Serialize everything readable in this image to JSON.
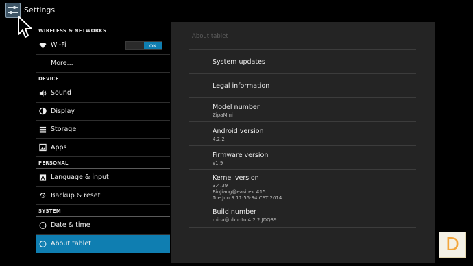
{
  "app": {
    "title": "Settings"
  },
  "sidebar": {
    "sections": [
      {
        "header": "WIRELESS & NETWORKS",
        "items": [
          {
            "label": "Wi-Fi",
            "icon": "wifi-icon",
            "toggle": "ON"
          },
          {
            "label": "More...",
            "icon": ""
          }
        ]
      },
      {
        "header": "DEVICE",
        "items": [
          {
            "label": "Sound",
            "icon": "volume-icon"
          },
          {
            "label": "Display",
            "icon": "brightness-icon"
          },
          {
            "label": "Storage",
            "icon": "storage-icon"
          },
          {
            "label": "Apps",
            "icon": "apps-icon"
          }
        ]
      },
      {
        "header": "PERSONAL",
        "items": [
          {
            "label": "Language & input",
            "icon": "keyboard-icon"
          },
          {
            "label": "Backup & reset",
            "icon": "backup-icon"
          }
        ]
      },
      {
        "header": "SYSTEM",
        "items": [
          {
            "label": "Date & time",
            "icon": "clock-icon"
          },
          {
            "label": "About tablet",
            "icon": "info-icon",
            "selected": true
          }
        ]
      }
    ]
  },
  "panel": {
    "title": "About tablet",
    "rows": [
      {
        "title": "System updates"
      },
      {
        "title": "Legal information"
      },
      {
        "title": "Model number",
        "sub": [
          "ZipaMini"
        ]
      },
      {
        "title": "Android version",
        "sub": [
          "4.2.2"
        ]
      },
      {
        "title": "Firmware version",
        "sub": [
          "v1.9"
        ]
      },
      {
        "title": "Kernel version",
        "sub": [
          "3.4.39",
          "BinJiang@easitek #15",
          "Tue Jun 3 11:55:34 CST 2014"
        ]
      },
      {
        "title": "Build number",
        "sub": [
          "miha@ubuntu 4.2.2 JDQ39"
        ]
      }
    ]
  },
  "watermark": {
    "letter": "D"
  },
  "colors": {
    "accent": "#33b5e5",
    "selected": "#0f7eb1",
    "panel": "#242424"
  }
}
